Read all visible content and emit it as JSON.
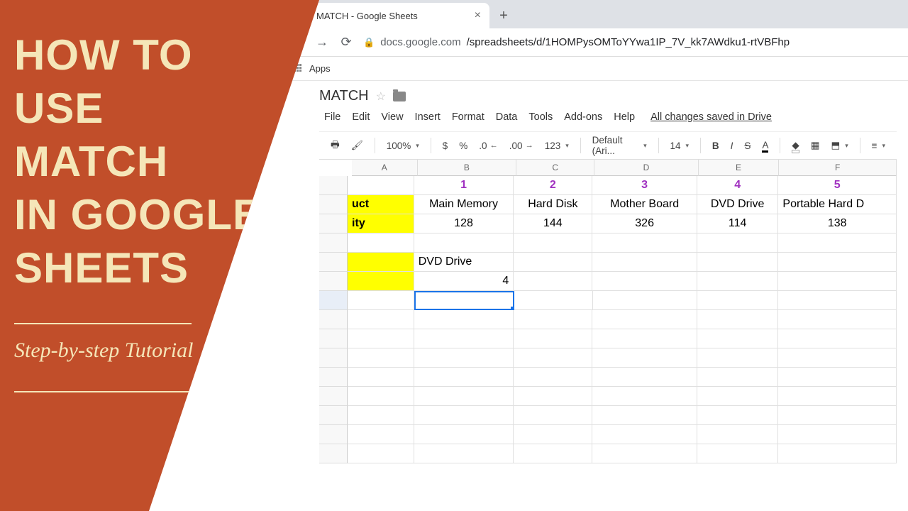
{
  "overlay": {
    "title_lines": [
      "HOW TO",
      "USE",
      "MATCH",
      "IN GOOGLE",
      "SHEETS"
    ],
    "subtitle": "Step-by-step Tutorial"
  },
  "browser": {
    "tab_title": "MATCH - Google Sheets",
    "url_host": "docs.google.com",
    "url_path": "/spreadsheets/d/1HOMPysOMToYYwa1IP_7V_kk7AWdku1-rtVBFhp",
    "bookmark_apps": "Apps"
  },
  "doc": {
    "title": "MATCH",
    "menus": [
      "File",
      "Edit",
      "View",
      "Insert",
      "Format",
      "Data",
      "Tools",
      "Add-ons",
      "Help"
    ],
    "saved": "All changes saved in Drive"
  },
  "toolbar": {
    "zoom": "100%",
    "currency": "$",
    "percent": "%",
    "dec_less": ".0",
    "dec_more": ".00",
    "numfmt": "123",
    "font": "Default (Ari...",
    "fontsize": "14"
  },
  "chart_data": {
    "type": "table",
    "columns": [
      "A",
      "B",
      "C",
      "D",
      "E",
      "F"
    ],
    "header_numbers": [
      "1",
      "2",
      "3",
      "4",
      "5"
    ],
    "products_label": "uct",
    "quantity_label": "ity",
    "products": [
      "Main Memory",
      "Hard Disk",
      "Mother Board",
      "DVD Drive",
      "Portable Hard D"
    ],
    "quantities": [
      128,
      144,
      326,
      114,
      138
    ],
    "lookup_label": "",
    "lookup_value": "DVD Drive",
    "result_value": 4
  }
}
